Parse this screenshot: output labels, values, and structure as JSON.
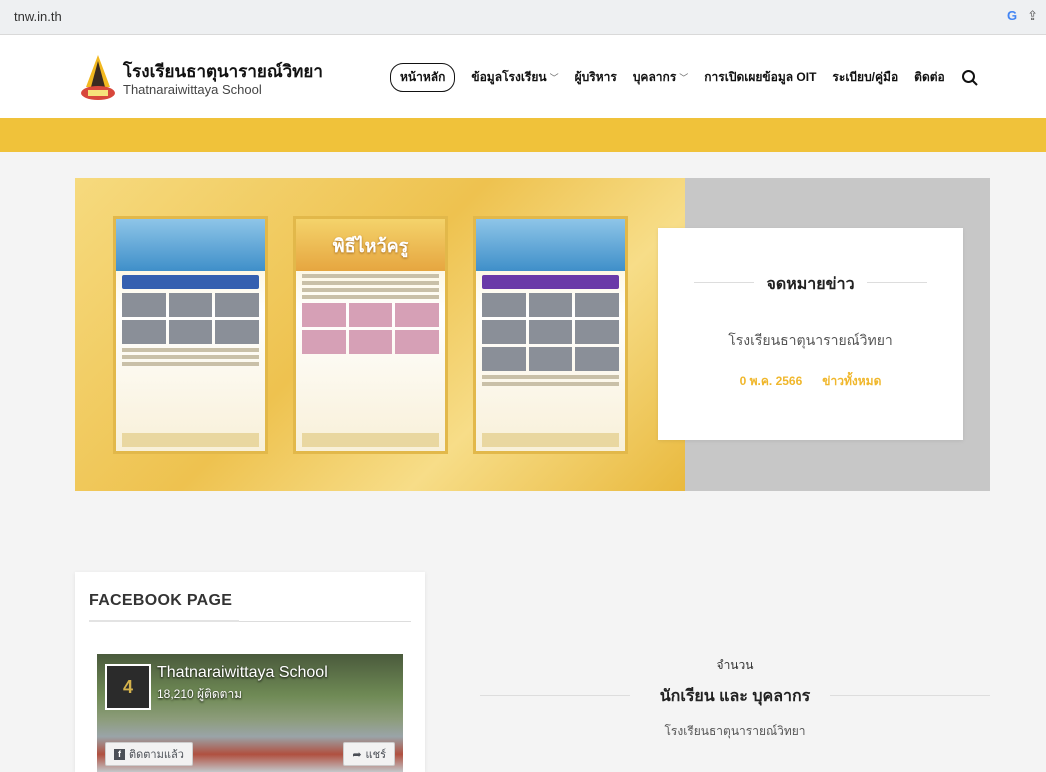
{
  "browser": {
    "url": "tnw.in.th"
  },
  "header": {
    "brand_th": "โรงเรียนธาตุนารายณ์วิทยา",
    "brand_en": "Thatnaraiwittaya School",
    "nav": [
      {
        "label": "หน้าหลัก",
        "active": true,
        "dropdown": false
      },
      {
        "label": "ข้อมูลโรงเรียน",
        "active": false,
        "dropdown": true
      },
      {
        "label": "ผู้บริหาร",
        "active": false,
        "dropdown": false
      },
      {
        "label": "บุคลากร",
        "active": false,
        "dropdown": true
      },
      {
        "label": "การเปิดเผยข้อมูล OIT",
        "active": false,
        "dropdown": false
      },
      {
        "label": "ระเบียบ/คู่มือ",
        "active": false,
        "dropdown": false
      },
      {
        "label": "ติดต่อ",
        "active": false,
        "dropdown": false
      }
    ]
  },
  "colors": {
    "accent_yellow": "#f0c23a",
    "meta_gold": "#f0b72c"
  },
  "hero": {
    "poster_title": "พิธีไหว้ครู",
    "news_title": "จดหมายข่าว",
    "news_subtitle": "โรงเรียนธาตุนารายณ์วิทยา",
    "news_date": "0 พ.ค. 2566",
    "news_all": "ข่าวทั้งหมด"
  },
  "facebook": {
    "heading": "FACEBOOK PAGE",
    "page_name": "Thatnaraiwittaya School",
    "followers": "18,210 ผู้ติดตาม",
    "follow_label": "ติดตามแล้ว",
    "share_label": "แชร์"
  },
  "stats": {
    "label": "จำนวน",
    "title": "นักเรียน และ บุคลากร",
    "subtitle": "โรงเรียนธาตุนารายณ์วิทยา"
  }
}
